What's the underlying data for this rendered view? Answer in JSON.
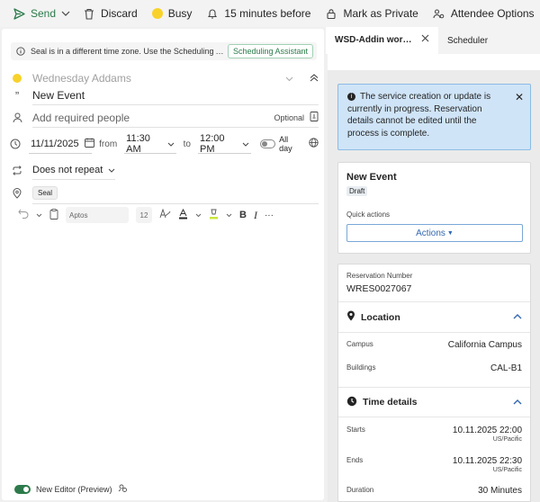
{
  "toolbar": {
    "send": "Send",
    "discard": "Discard",
    "busy": "Busy",
    "reminder": "15 minutes before",
    "private": "Mark as Private",
    "attendee": "Attendee Options",
    "more": "···"
  },
  "banner": {
    "message": "Seal is in a different time zone. Use the Scheduling Assistant to selec...",
    "button": "Scheduling Assistant"
  },
  "compose": {
    "organizer": "Wednesday Addams",
    "title": "New Event",
    "attendees_placeholder": "Add required people",
    "optional": "Optional",
    "start_date": "11/11/2025",
    "from_label": "from",
    "start_time": "11:30 AM",
    "to_label": "to",
    "end_time": "12:00 PM",
    "all_day": "All day",
    "repeat": "Does not repeat",
    "location_chip": "Seal",
    "font": "Aptos",
    "font_size": "12",
    "editor_toggle": "New Editor (Preview)"
  },
  "tabs": {
    "active": "WSD-Addin workplace",
    "other": "Scheduler"
  },
  "notice": {
    "text": "The service creation or update is currently in progress. Reservation details cannot be edited until the process is complete."
  },
  "event": {
    "title": "New Event",
    "status": "Draft",
    "quick_actions": "Quick actions",
    "actions_button": "Actions"
  },
  "details": {
    "reservation_label": "Reservation Number",
    "reservation_value": "WRES0027067",
    "location_heading": "Location",
    "campus_label": "Campus",
    "campus_value": "California Campus",
    "buildings_label": "Buildings",
    "buildings_value": "CAL-B1",
    "time_heading": "Time details",
    "starts_label": "Starts",
    "starts_value": "10.11.2025 22:00",
    "starts_tz": "US/Pacific",
    "ends_label": "Ends",
    "ends_value": "10.11.2025 22:30",
    "ends_tz": "US/Pacific",
    "duration_label": "Duration",
    "duration_value": "30 Minutes"
  },
  "colors": {
    "accent_green": "#2c7a4b",
    "busy_yellow": "#f8d22a",
    "notice_blue": "#cfe4f7",
    "link_blue": "#3367b1"
  }
}
